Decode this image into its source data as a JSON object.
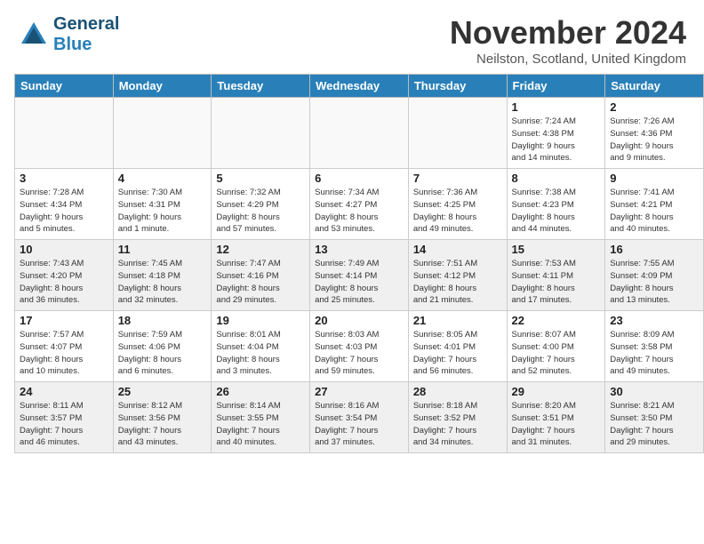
{
  "header": {
    "logo_line1": "General",
    "logo_line2": "Blue",
    "title": "November 2024",
    "location": "Neilston, Scotland, United Kingdom"
  },
  "weekdays": [
    "Sunday",
    "Monday",
    "Tuesday",
    "Wednesday",
    "Thursday",
    "Friday",
    "Saturday"
  ],
  "weeks": [
    [
      {
        "day": "",
        "info": "",
        "empty": true
      },
      {
        "day": "",
        "info": "",
        "empty": true
      },
      {
        "day": "",
        "info": "",
        "empty": true
      },
      {
        "day": "",
        "info": "",
        "empty": true
      },
      {
        "day": "",
        "info": "",
        "empty": true
      },
      {
        "day": "1",
        "info": "Sunrise: 7:24 AM\nSunset: 4:38 PM\nDaylight: 9 hours\nand 14 minutes."
      },
      {
        "day": "2",
        "info": "Sunrise: 7:26 AM\nSunset: 4:36 PM\nDaylight: 9 hours\nand 9 minutes."
      }
    ],
    [
      {
        "day": "3",
        "info": "Sunrise: 7:28 AM\nSunset: 4:34 PM\nDaylight: 9 hours\nand 5 minutes."
      },
      {
        "day": "4",
        "info": "Sunrise: 7:30 AM\nSunset: 4:31 PM\nDaylight: 9 hours\nand 1 minute."
      },
      {
        "day": "5",
        "info": "Sunrise: 7:32 AM\nSunset: 4:29 PM\nDaylight: 8 hours\nand 57 minutes."
      },
      {
        "day": "6",
        "info": "Sunrise: 7:34 AM\nSunset: 4:27 PM\nDaylight: 8 hours\nand 53 minutes."
      },
      {
        "day": "7",
        "info": "Sunrise: 7:36 AM\nSunset: 4:25 PM\nDaylight: 8 hours\nand 49 minutes."
      },
      {
        "day": "8",
        "info": "Sunrise: 7:38 AM\nSunset: 4:23 PM\nDaylight: 8 hours\nand 44 minutes."
      },
      {
        "day": "9",
        "info": "Sunrise: 7:41 AM\nSunset: 4:21 PM\nDaylight: 8 hours\nand 40 minutes."
      }
    ],
    [
      {
        "day": "10",
        "info": "Sunrise: 7:43 AM\nSunset: 4:20 PM\nDaylight: 8 hours\nand 36 minutes.",
        "shaded": true
      },
      {
        "day": "11",
        "info": "Sunrise: 7:45 AM\nSunset: 4:18 PM\nDaylight: 8 hours\nand 32 minutes.",
        "shaded": true
      },
      {
        "day": "12",
        "info": "Sunrise: 7:47 AM\nSunset: 4:16 PM\nDaylight: 8 hours\nand 29 minutes.",
        "shaded": true
      },
      {
        "day": "13",
        "info": "Sunrise: 7:49 AM\nSunset: 4:14 PM\nDaylight: 8 hours\nand 25 minutes.",
        "shaded": true
      },
      {
        "day": "14",
        "info": "Sunrise: 7:51 AM\nSunset: 4:12 PM\nDaylight: 8 hours\nand 21 minutes.",
        "shaded": true
      },
      {
        "day": "15",
        "info": "Sunrise: 7:53 AM\nSunset: 4:11 PM\nDaylight: 8 hours\nand 17 minutes.",
        "shaded": true
      },
      {
        "day": "16",
        "info": "Sunrise: 7:55 AM\nSunset: 4:09 PM\nDaylight: 8 hours\nand 13 minutes.",
        "shaded": true
      }
    ],
    [
      {
        "day": "17",
        "info": "Sunrise: 7:57 AM\nSunset: 4:07 PM\nDaylight: 8 hours\nand 10 minutes."
      },
      {
        "day": "18",
        "info": "Sunrise: 7:59 AM\nSunset: 4:06 PM\nDaylight: 8 hours\nand 6 minutes."
      },
      {
        "day": "19",
        "info": "Sunrise: 8:01 AM\nSunset: 4:04 PM\nDaylight: 8 hours\nand 3 minutes."
      },
      {
        "day": "20",
        "info": "Sunrise: 8:03 AM\nSunset: 4:03 PM\nDaylight: 7 hours\nand 59 minutes."
      },
      {
        "day": "21",
        "info": "Sunrise: 8:05 AM\nSunset: 4:01 PM\nDaylight: 7 hours\nand 56 minutes."
      },
      {
        "day": "22",
        "info": "Sunrise: 8:07 AM\nSunset: 4:00 PM\nDaylight: 7 hours\nand 52 minutes."
      },
      {
        "day": "23",
        "info": "Sunrise: 8:09 AM\nSunset: 3:58 PM\nDaylight: 7 hours\nand 49 minutes."
      }
    ],
    [
      {
        "day": "24",
        "info": "Sunrise: 8:11 AM\nSunset: 3:57 PM\nDaylight: 7 hours\nand 46 minutes.",
        "shaded": true
      },
      {
        "day": "25",
        "info": "Sunrise: 8:12 AM\nSunset: 3:56 PM\nDaylight: 7 hours\nand 43 minutes.",
        "shaded": true
      },
      {
        "day": "26",
        "info": "Sunrise: 8:14 AM\nSunset: 3:55 PM\nDaylight: 7 hours\nand 40 minutes.",
        "shaded": true
      },
      {
        "day": "27",
        "info": "Sunrise: 8:16 AM\nSunset: 3:54 PM\nDaylight: 7 hours\nand 37 minutes.",
        "shaded": true
      },
      {
        "day": "28",
        "info": "Sunrise: 8:18 AM\nSunset: 3:52 PM\nDaylight: 7 hours\nand 34 minutes.",
        "shaded": true
      },
      {
        "day": "29",
        "info": "Sunrise: 8:20 AM\nSunset: 3:51 PM\nDaylight: 7 hours\nand 31 minutes.",
        "shaded": true
      },
      {
        "day": "30",
        "info": "Sunrise: 8:21 AM\nSunset: 3:50 PM\nDaylight: 7 hours\nand 29 minutes.",
        "shaded": true
      }
    ]
  ]
}
